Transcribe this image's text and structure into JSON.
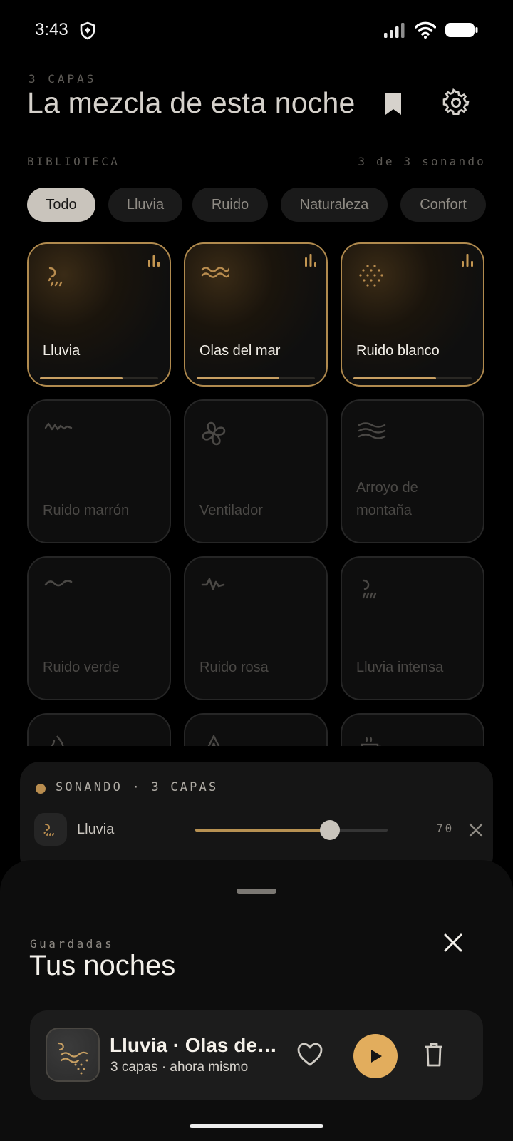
{
  "status": {
    "time": "3:43"
  },
  "header": {
    "layer_count": "3 CAPAS",
    "title": "La mezcla de esta noche"
  },
  "library": {
    "label": "BIBLIOTECA",
    "count": "3 de 3 sonando",
    "filters": [
      "Todo",
      "Lluvia",
      "Ruido",
      "Naturaleza",
      "Confort"
    ],
    "active_filter": "Todo",
    "sounds": [
      {
        "name": "Lluvia",
        "icon": "rain-icon",
        "playing": true,
        "volume": 0.7
      },
      {
        "name": "Olas del mar",
        "icon": "waves-icon",
        "playing": true,
        "volume": 0.7
      },
      {
        "name": "Ruido blanco",
        "icon": "white-noise-icon",
        "playing": true,
        "volume": 0.7
      },
      {
        "name": "Ruido marrón",
        "icon": "squiggle-icon",
        "playing": false
      },
      {
        "name": "Ventilador",
        "icon": "fan-icon",
        "playing": false
      },
      {
        "name": "Arroyo de montaña",
        "icon": "stream-icon",
        "playing": false
      },
      {
        "name": "Ruido verde",
        "icon": "tilde-icon",
        "playing": false
      },
      {
        "name": "Ruido rosa",
        "icon": "pulse-icon",
        "playing": false
      },
      {
        "name": "Lluvia intensa",
        "icon": "heavy-rain-icon",
        "playing": false
      },
      {
        "name": "",
        "icon": "fire-icon",
        "playing": false
      },
      {
        "name": "",
        "icon": "tent-icon",
        "playing": false
      },
      {
        "name": "",
        "icon": "coffee-icon",
        "playing": false
      }
    ]
  },
  "now_playing": {
    "label": "SONANDO · 3 CAPAS",
    "track": {
      "name": "Lluvia",
      "volume": 70,
      "volume_text": "70"
    }
  },
  "saved": {
    "label": "Guardadas",
    "title": "Tus noches",
    "items": [
      {
        "title": "Lluvia · Olas del mar · Ruido blanco",
        "subtitle": "3 capas · ahora mismo"
      }
    ]
  },
  "colors": {
    "accent": "#e2ad5d",
    "accent_line": "#c8a063",
    "border_active": "#b08a4e"
  }
}
